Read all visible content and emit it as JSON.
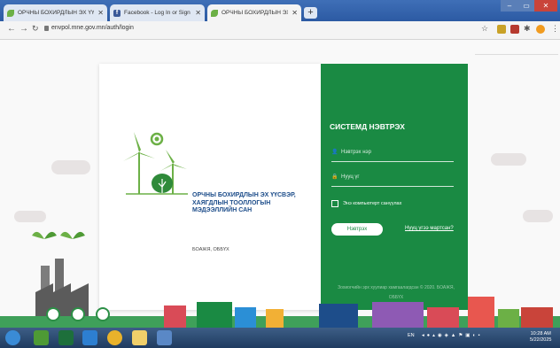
{
  "browser": {
    "tabs": [
      {
        "title": "ОРЧНЫ БОХИРДЛЫН ЭХ ҮҮСВЭ",
        "icon": "leaf-icon",
        "active": false
      },
      {
        "title": "Facebook - Log In or Sign Up",
        "icon": "facebook-icon",
        "active": false
      },
      {
        "title": "ОРЧНЫ БОХИРДЛЫН ЭХ ҮҮСВЭ",
        "icon": "leaf-icon",
        "active": true
      }
    ],
    "new_tab": "+",
    "url": "envpol.mne.gov.mn/auth/login"
  },
  "org": {
    "name_line1": "ОРЧНЫ БОХИРДЛЫН ЭХ ҮҮСВЭР,",
    "name_line2": "ХАЯГДЛЫН ТООЛЛОГЫН",
    "name_line3": "МЭДЭЭЛЛИЙН САН",
    "ministry": "БОАЖЯ, ОББҮХ"
  },
  "login": {
    "title": "СИСТЕМД НЭВТРЭХ",
    "username_placeholder": "Нэвтрэх нэр",
    "password_placeholder": "Нууц үг",
    "remember_label": "Энэ компьютерт санүүлах",
    "submit_label": "Нэвтрэх",
    "forgot_label": "Нууц үгээ мартсан?",
    "copyright_line1": "Зохиогчийн эрх хуулиар хамгаалагдсан © 2020. БОАЖЯ,",
    "copyright_line2": "ОББҮХ"
  },
  "taskbar": {
    "tray_lang": "EN",
    "time": "10:28 AM",
    "date": "5/22/2025"
  },
  "colors": {
    "accent_green": "#1a8a43",
    "org_blue": "#1d4d8a",
    "taskbar": "#2c4b73"
  }
}
